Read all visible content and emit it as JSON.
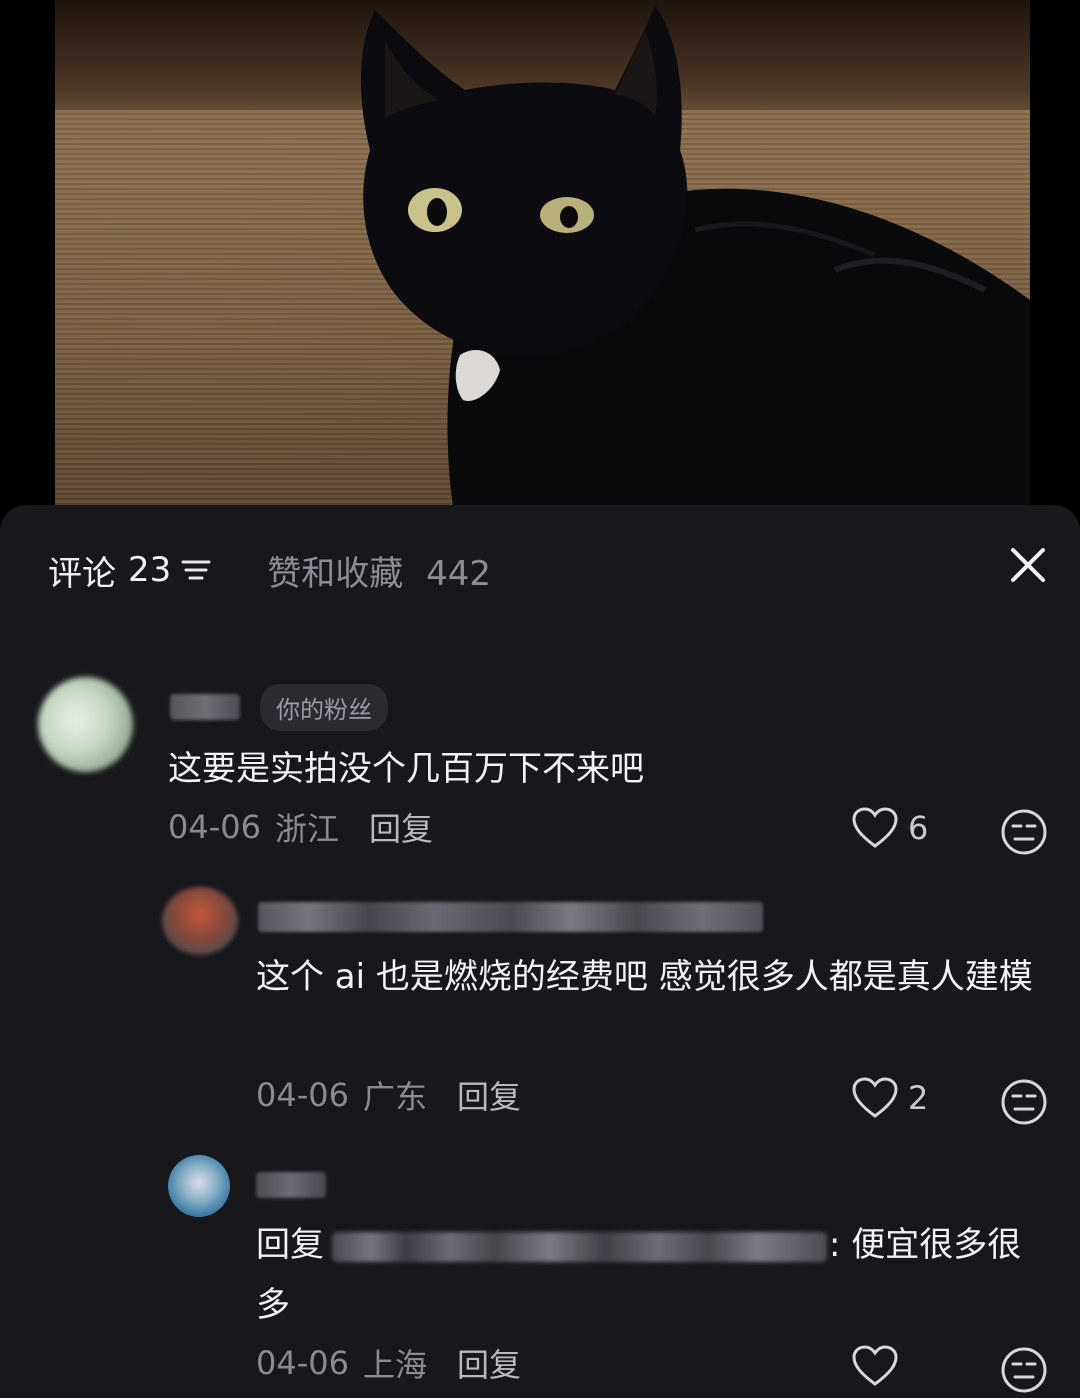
{
  "header": {
    "comments_tab": {
      "label": "评论",
      "count": "23"
    },
    "likes_tab": {
      "label": "赞和收藏",
      "count": "442"
    }
  },
  "icons": {
    "sort": "sort-lines-icon",
    "close": "close-icon",
    "like": "heart-outline-icon",
    "dislike": "meh-face-icon"
  },
  "colors": {
    "sheet_bg": "#17171c",
    "text_primary": "#f3f3f5",
    "text_secondary": "#8a8a92",
    "badge_bg": "#2a2a31"
  },
  "comments": [
    {
      "author_badge": "你的粉丝",
      "text": "这要是实拍没个几百万下不来吧",
      "date": "04-06",
      "region": "浙江",
      "reply_label": "回复",
      "likes": "6"
    },
    {
      "text": "这个 ai 也是燃烧的经费吧 感觉很多人都是真人建模",
      "date": "04-06",
      "region": "广东",
      "reply_label": "回复",
      "likes": "2"
    },
    {
      "text_prefix": "回复",
      "text_suffix": ": 便宜很多很多",
      "date": "04-06",
      "region": "上海",
      "reply_label": "回复",
      "likes": ""
    }
  ]
}
